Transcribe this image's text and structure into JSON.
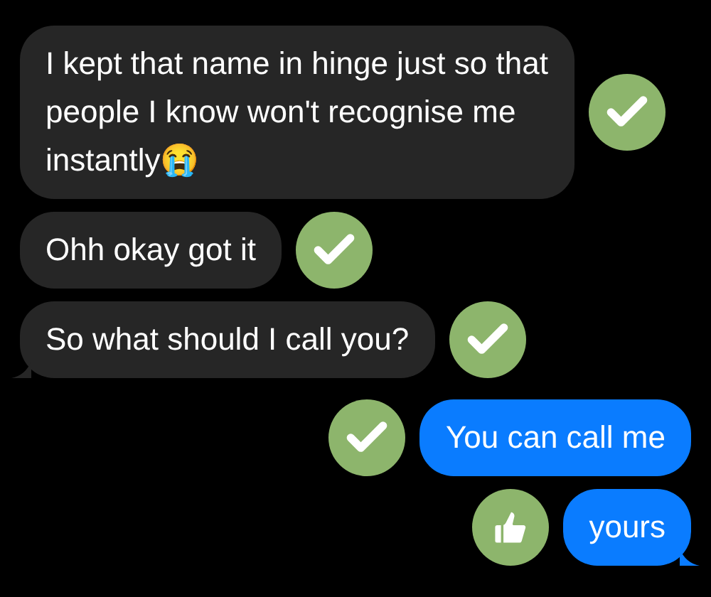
{
  "messages": [
    {
      "kind": "incoming",
      "text": "I kept that name in hinge just so that people I know won't recognise me instantly😭",
      "reaction": {
        "kind": "check"
      },
      "tail": false
    },
    {
      "kind": "incoming",
      "text": "Ohh okay got it",
      "reaction": {
        "kind": "check"
      },
      "tail": false
    },
    {
      "kind": "incoming",
      "text": "So what should I call you?",
      "reaction": {
        "kind": "check"
      },
      "tail": true
    },
    {
      "kind": "outgoing",
      "text": "You can call me",
      "reaction": {
        "kind": "check"
      },
      "tail": false
    },
    {
      "kind": "outgoing",
      "text": "yours",
      "reaction": {
        "kind": "thumbs"
      },
      "tail": true
    }
  ]
}
